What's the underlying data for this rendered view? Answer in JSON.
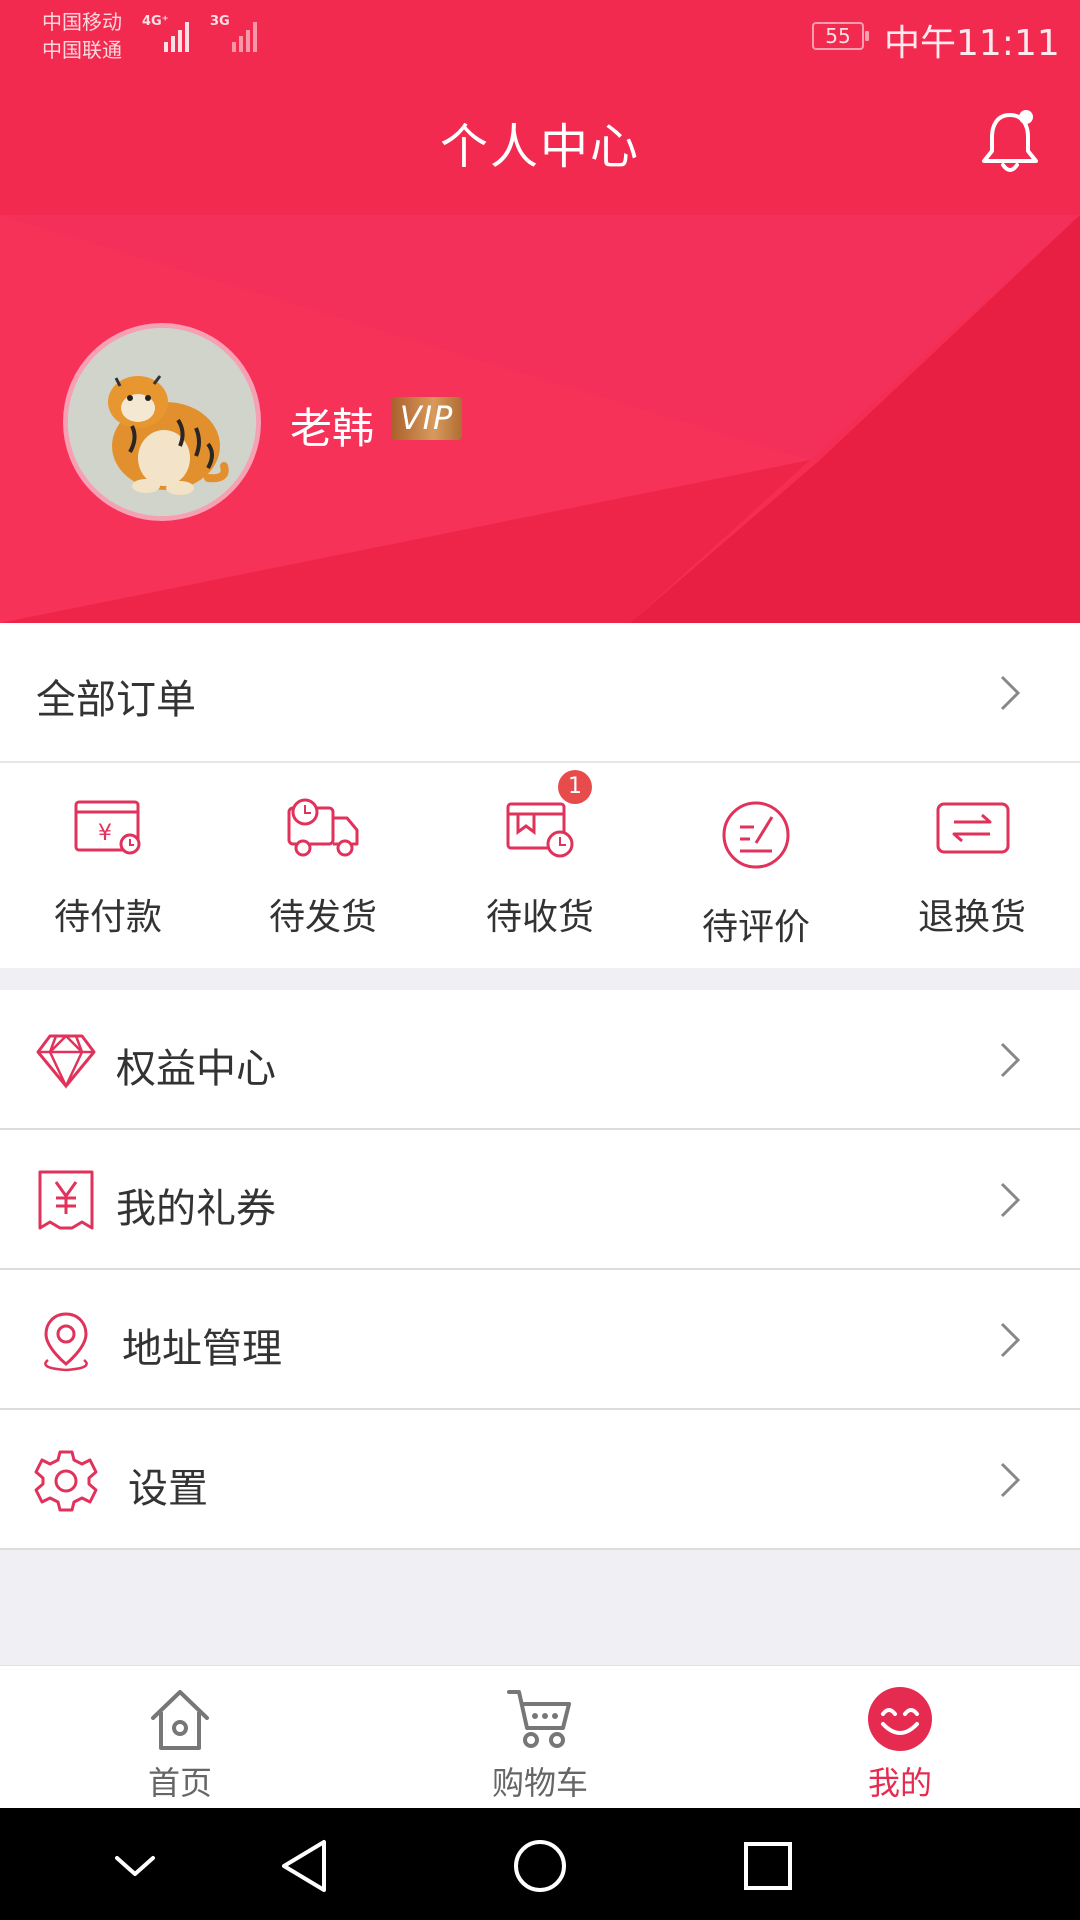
{
  "status_bar": {
    "carrier_1": "中国移动",
    "carrier_2": "中国联通",
    "network_1": "4G⁺",
    "network_2": "3G",
    "battery": "55",
    "time": "中午11:11"
  },
  "header": {
    "title": "个人中心",
    "notification_icon": "bell-icon",
    "notification_dot": true
  },
  "profile": {
    "avatar": "tiger-avatar",
    "name": "老韩",
    "vip": "VIP"
  },
  "orders": {
    "title": "全部订单",
    "statuses": [
      {
        "label": "待付款",
        "icon": "wallet-icon"
      },
      {
        "label": "待发货",
        "icon": "truck-icon"
      },
      {
        "label": "待收货",
        "icon": "delivery-clock-icon",
        "badge": "1"
      },
      {
        "label": "待评价",
        "icon": "review-icon"
      },
      {
        "label": "退换货",
        "icon": "exchange-icon"
      }
    ]
  },
  "menu": [
    {
      "label": "权益中心",
      "icon": "diamond-icon"
    },
    {
      "label": "我的礼券",
      "icon": "coupon-icon"
    },
    {
      "label": "地址管理",
      "icon": "location-icon"
    },
    {
      "label": "设置",
      "icon": "gear-icon"
    }
  ],
  "tabbar": [
    {
      "label": "首页",
      "icon": "home-icon"
    },
    {
      "label": "购物车",
      "icon": "cart-icon"
    },
    {
      "label": "我的",
      "icon": "smiley-icon",
      "active": true
    }
  ],
  "colors": {
    "brand": "#f22a4f",
    "brand_dark": "#e01e45",
    "icon": "#e0325a",
    "active_tab": "#e62b51"
  }
}
